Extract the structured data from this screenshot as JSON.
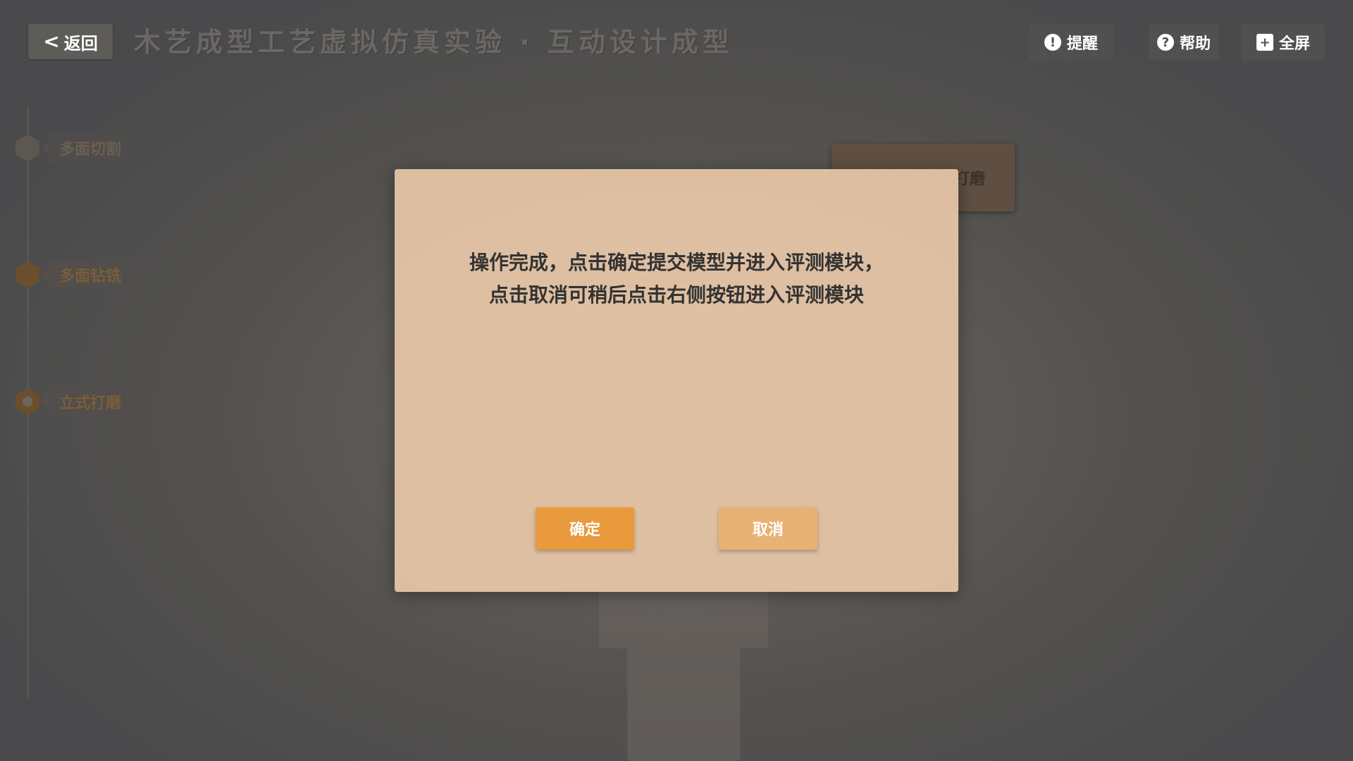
{
  "header": {
    "back_label": "返回",
    "title": "木艺成型工艺虚拟仿真实验 · 互动设计成型",
    "remind_label": "提醒",
    "help_label": "帮助",
    "fullscreen_label": "全屏"
  },
  "steps": [
    {
      "label": "多面切割",
      "state": "done"
    },
    {
      "label": "多面钻铣",
      "state": "done"
    },
    {
      "label": "立式打磨",
      "state": "active"
    }
  ],
  "action_card": {
    "label": "点击进行立式打磨"
  },
  "dialog": {
    "message_line1": "操作完成，点击确定提交模型并进入评测模块，",
    "message_line2": "点击取消可稍后点击右侧按钮进入评测模块",
    "confirm_label": "确定",
    "cancel_label": "取消"
  },
  "colors": {
    "overlay": "#4a4a4c",
    "dialog_bg": "#e9c8a8",
    "confirm": "#e89a3c",
    "cancel": "#e8b275",
    "accent": "#6b4e2c"
  },
  "icons": [
    "back-chevron-icon",
    "lightbulb-icon",
    "question-icon",
    "fullscreen-icon",
    "hexagon-icon"
  ]
}
